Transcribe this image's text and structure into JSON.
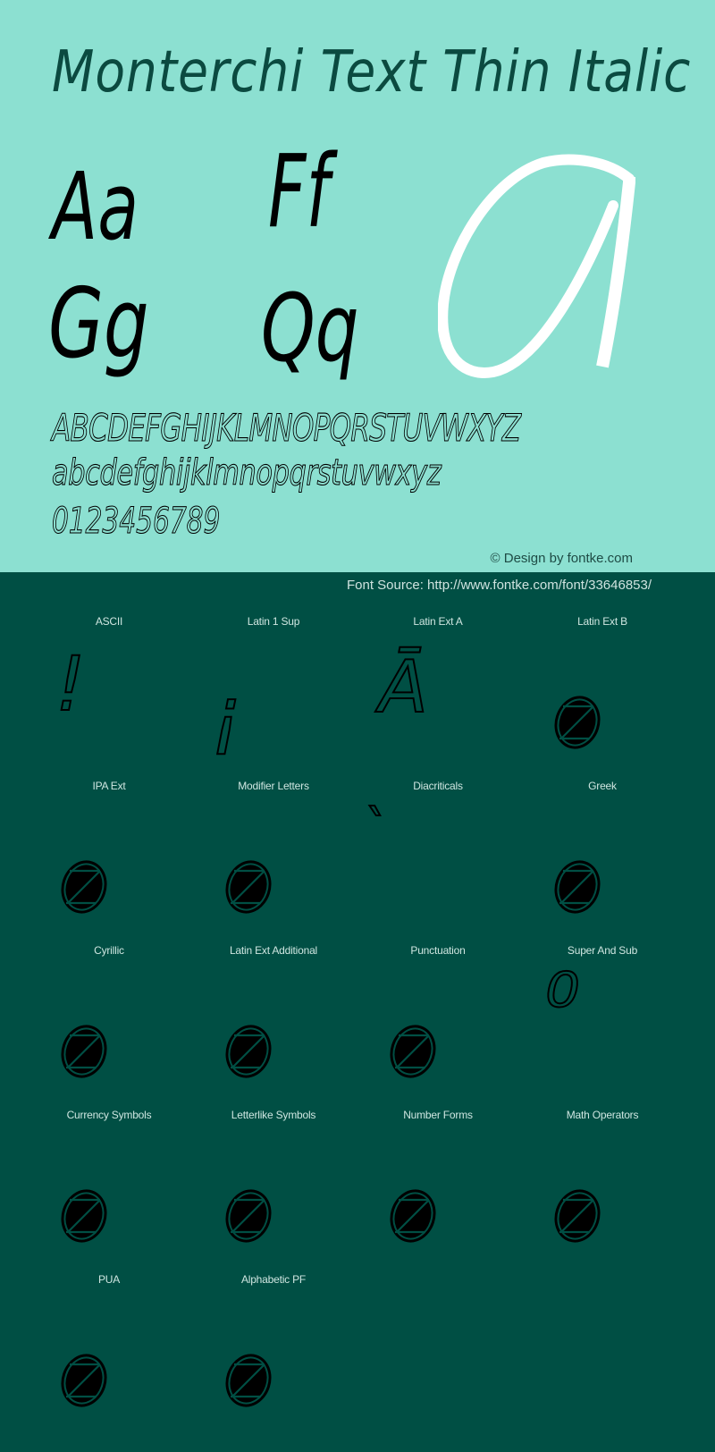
{
  "header": {
    "font_name": "Monterchi Text Thin Italic"
  },
  "specimen": {
    "pairs": [
      "Aa",
      "Ff",
      "Gg",
      "Qq"
    ],
    "feature_glyph": "a",
    "uppercase": "ABCDEFGHIJKLMNOPQRSTUVWXYZ",
    "lowercase": "abcdefghijklmnopqrstuvwxyz",
    "digits": "0123456789"
  },
  "footer": {
    "credit": "© Design by fontke.com",
    "source": "Font Source: http://www.fontke.com/font/33646853/"
  },
  "colors": {
    "top_background": "#8ce0d1",
    "bottom_background": "#004f44",
    "feature_glyph": "#ffffff",
    "glyph_ink": "#000000"
  },
  "blocks": [
    {
      "label": "ASCII",
      "glyph": "!",
      "supported": true
    },
    {
      "label": "Latin 1 Sup",
      "glyph": "¡",
      "supported": true
    },
    {
      "label": "Latin Ext A",
      "glyph": "Ā",
      "supported": true
    },
    {
      "label": "Latin Ext B",
      "glyph": "not-found-icon",
      "supported": false
    },
    {
      "label": "IPA Ext",
      "glyph": "not-found-icon",
      "supported": false
    },
    {
      "label": "Modifier Letters",
      "glyph": "not-found-icon",
      "supported": false
    },
    {
      "label": "Diacriticals",
      "glyph": "`",
      "supported": true
    },
    {
      "label": "Greek",
      "glyph": "not-found-icon",
      "supported": false
    },
    {
      "label": "Cyrillic",
      "glyph": "not-found-icon",
      "supported": false
    },
    {
      "label": "Latin Ext Additional",
      "glyph": "not-found-icon",
      "supported": false
    },
    {
      "label": "Punctuation",
      "glyph": "not-found-icon",
      "supported": false
    },
    {
      "label": "Super And Sub",
      "glyph": "⁰",
      "supported": true
    },
    {
      "label": "Currency Symbols",
      "glyph": "not-found-icon",
      "supported": false
    },
    {
      "label": "Letterlike Symbols",
      "glyph": "not-found-icon",
      "supported": false
    },
    {
      "label": "Number Forms",
      "glyph": "not-found-icon",
      "supported": false
    },
    {
      "label": "Math Operators",
      "glyph": "not-found-icon",
      "supported": false
    },
    {
      "label": "PUA",
      "glyph": "not-found-icon",
      "supported": false
    },
    {
      "label": "Alphabetic PF",
      "glyph": "not-found-icon",
      "supported": false
    }
  ]
}
